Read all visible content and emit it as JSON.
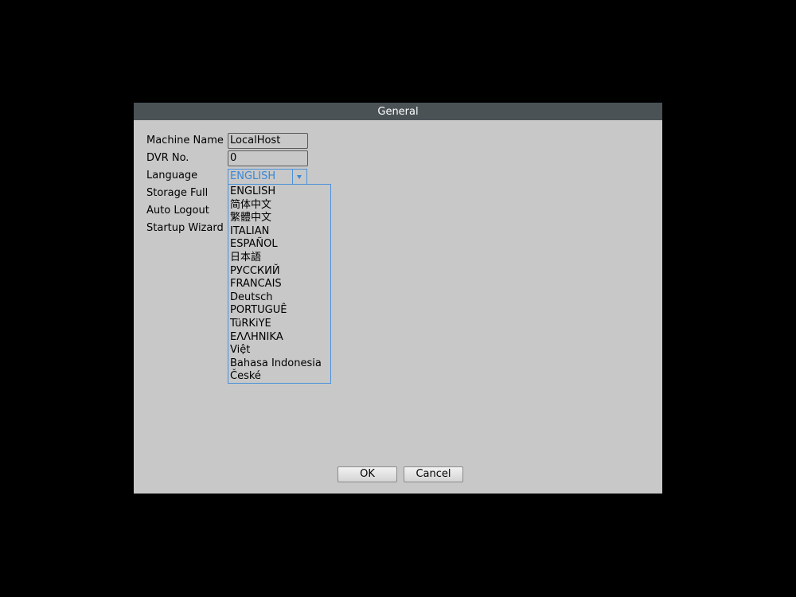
{
  "dialog": {
    "title": "General"
  },
  "form": {
    "machine_name_label": "Machine Name",
    "machine_name_value": "LocalHost",
    "dvr_no_label": "DVR No.",
    "dvr_no_value": "0",
    "language_label": "Language",
    "language_value": "ENGLISH",
    "storage_full_label": "Storage Full",
    "auto_logout_label": "Auto Logout",
    "startup_wizard_label": "Startup Wizard"
  },
  "language_options": [
    "ENGLISH",
    "简体中文",
    "繁體中文",
    "ITALIAN",
    "ESPAÑOL",
    "日本語",
    "РУССКИЙ",
    "FRANCAIS",
    "Deutsch",
    "PORTUGUÊ",
    "TüRKiYE",
    "ΕΛΛΗΝΙΚΑ",
    "Việt",
    "Bahasa Indonesia",
    "České"
  ],
  "buttons": {
    "ok_label": "OK",
    "cancel_label": "Cancel"
  },
  "colors": {
    "titlebar": "#4a5256",
    "dialog_bg": "#c8c8c8",
    "accent": "#3a87d6"
  },
  "icons": {
    "language_dropdown": "chevron-down-icon"
  }
}
